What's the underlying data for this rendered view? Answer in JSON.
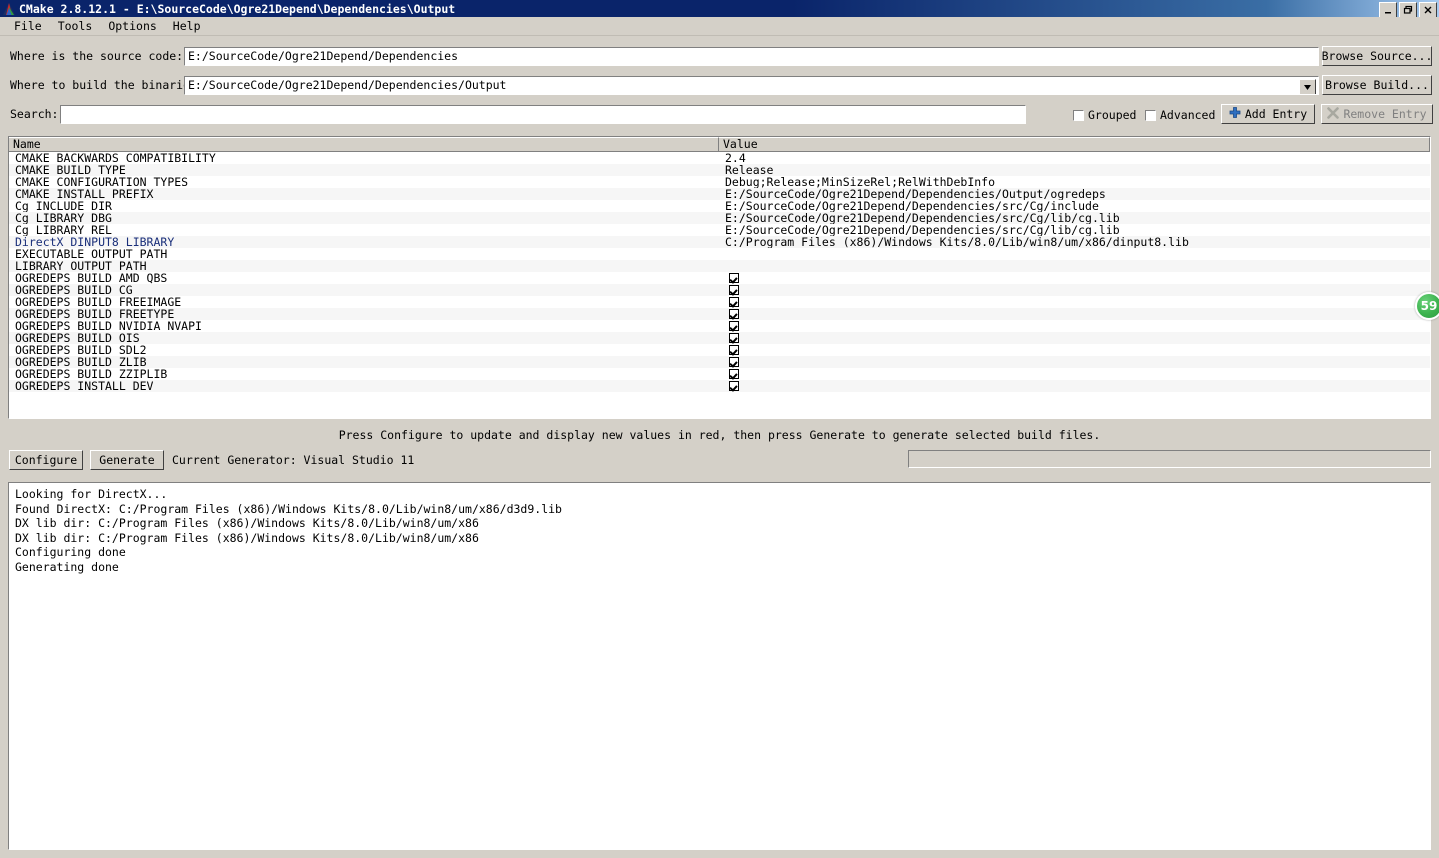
{
  "window": {
    "title": "CMake 2.8.12.1 - E:\\SourceCode\\Ogre21Depend\\Dependencies\\Output",
    "minimize_label": "–",
    "restore_label": "❐",
    "close_label": "✕"
  },
  "menu": {
    "items": [
      {
        "label": "File"
      },
      {
        "label": "Tools"
      },
      {
        "label": "Options"
      },
      {
        "label": "Help"
      }
    ]
  },
  "form": {
    "source_label": "Where is the source code:",
    "source_value": "E:/SourceCode/Ogre21Depend/Dependencies",
    "browse_source_label": "Browse Source...",
    "build_label": "Where to build the binaries:",
    "build_value": "E:/SourceCode/Ogre21Depend/Dependencies/Output",
    "browse_build_label": "Browse Build...",
    "search_label": "Search:",
    "search_value": "",
    "search_placeholder": "",
    "grouped_label": "Grouped",
    "grouped_checked": false,
    "advanced_label": "Advanced",
    "advanced_checked": false,
    "add_entry_label": "Add Entry",
    "remove_entry_label": "Remove Entry",
    "remove_entry_enabled": false
  },
  "cache_table": {
    "columns": [
      "Name",
      "Value"
    ],
    "rows": [
      {
        "name": "CMAKE_BACKWARDS_COMPATIBILITY",
        "value": "2.4",
        "type": "text",
        "new": false
      },
      {
        "name": "CMAKE_BUILD_TYPE",
        "value": "Release",
        "type": "text",
        "new": false
      },
      {
        "name": "CMAKE_CONFIGURATION_TYPES",
        "value": "Debug;Release;MinSizeRel;RelWithDebInfo",
        "type": "text",
        "new": false
      },
      {
        "name": "CMAKE_INSTALL_PREFIX",
        "value": "E:/SourceCode/Ogre21Depend/Dependencies/Output/ogredeps",
        "type": "text",
        "new": false
      },
      {
        "name": "Cg_INCLUDE_DIR",
        "value": "E:/SourceCode/Ogre21Depend/Dependencies/src/Cg/include",
        "type": "text",
        "new": false
      },
      {
        "name": "Cg_LIBRARY_DBG",
        "value": "E:/SourceCode/Ogre21Depend/Dependencies/src/Cg/lib/cg.lib",
        "type": "text",
        "new": false
      },
      {
        "name": "Cg_LIBRARY_REL",
        "value": "E:/SourceCode/Ogre21Depend/Dependencies/src/Cg/lib/cg.lib",
        "type": "text",
        "new": false
      },
      {
        "name": "DirectX_DINPUT8_LIBRARY",
        "value": "C:/Program Files (x86)/Windows Kits/8.0/Lib/win8/um/x86/dinput8.lib",
        "type": "text",
        "new": true
      },
      {
        "name": "EXECUTABLE_OUTPUT_PATH",
        "value": "",
        "type": "text",
        "new": false
      },
      {
        "name": "LIBRARY_OUTPUT_PATH",
        "value": "",
        "type": "text",
        "new": false
      },
      {
        "name": "OGREDEPS_BUILD_AMD_QBS",
        "value": "",
        "type": "checkbox",
        "checked": true,
        "new": false
      },
      {
        "name": "OGREDEPS_BUILD_CG",
        "value": "",
        "type": "checkbox",
        "checked": true,
        "new": false
      },
      {
        "name": "OGREDEPS_BUILD_FREEIMAGE",
        "value": "",
        "type": "checkbox",
        "checked": true,
        "new": false
      },
      {
        "name": "OGREDEPS_BUILD_FREETYPE",
        "value": "",
        "type": "checkbox",
        "checked": true,
        "new": false
      },
      {
        "name": "OGREDEPS_BUILD_NVIDIA_NVAPI",
        "value": "",
        "type": "checkbox",
        "checked": true,
        "new": false
      },
      {
        "name": "OGREDEPS_BUILD_OIS",
        "value": "",
        "type": "checkbox",
        "checked": true,
        "new": false
      },
      {
        "name": "OGREDEPS_BUILD_SDL2",
        "value": "",
        "type": "checkbox",
        "checked": true,
        "new": false
      },
      {
        "name": "OGREDEPS_BUILD_ZLIB",
        "value": "",
        "type": "checkbox",
        "checked": true,
        "new": false
      },
      {
        "name": "OGREDEPS_BUILD_ZZIPLIB",
        "value": "",
        "type": "checkbox",
        "checked": true,
        "new": false
      },
      {
        "name": "OGREDEPS_INSTALL_DEV",
        "value": "",
        "type": "checkbox",
        "checked": true,
        "new": false
      }
    ]
  },
  "actions": {
    "hint": "Press Configure to update and display new values in red, then press Generate to generate selected build files.",
    "configure_label": "Configure",
    "generate_label": "Generate",
    "current_generator": "Current Generator: Visual Studio 11",
    "progress_percent": 0
  },
  "log": {
    "lines": [
      "Looking for DirectX...",
      "Found DirectX: C:/Program Files (x86)/Windows Kits/8.0/Lib/win8/um/x86/d3d9.lib",
      "DX lib dir: C:/Program Files (x86)/Windows Kits/8.0/Lib/win8/um/x86",
      "DX lib dir: C:/Program Files (x86)/Windows Kits/8.0/Lib/win8/um/x86",
      "Configuring done",
      "Generating done"
    ]
  },
  "overlay_badge": {
    "value": "59",
    "color": "#3cb34e"
  }
}
